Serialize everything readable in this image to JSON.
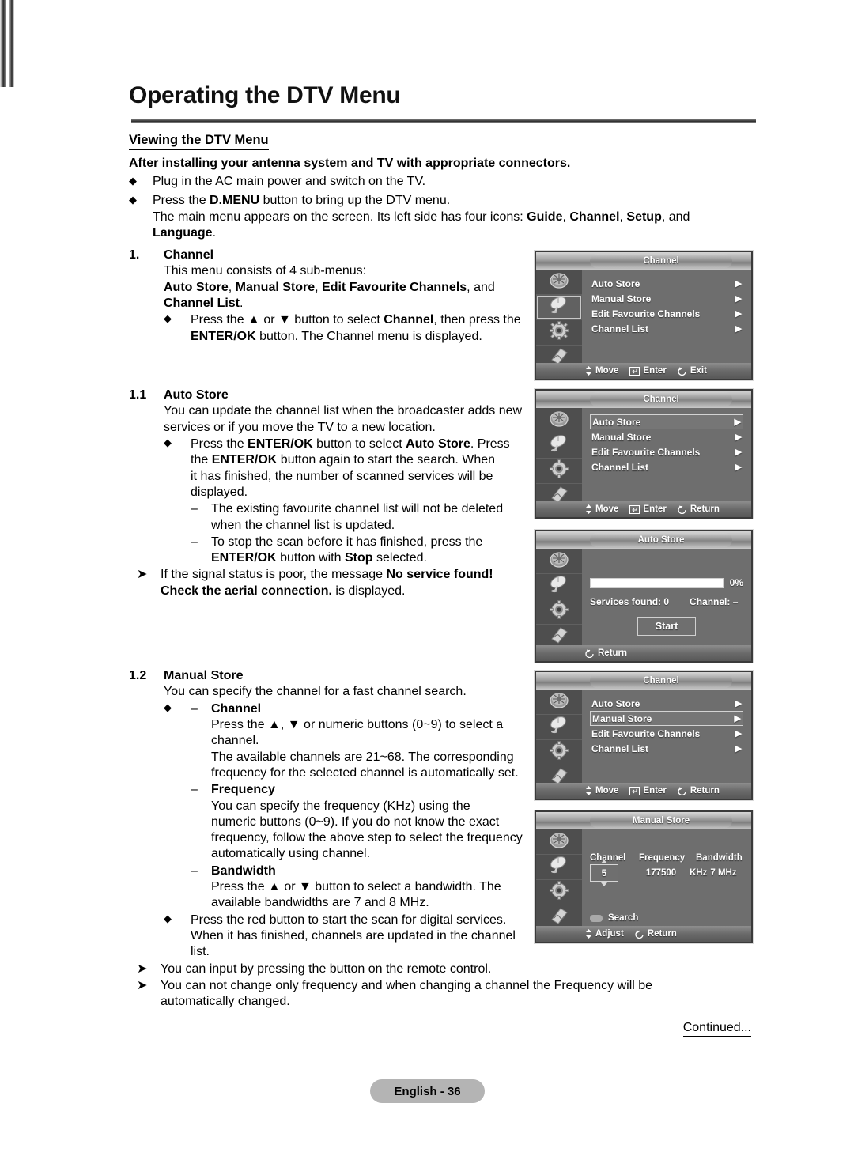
{
  "header": {
    "title": "Operating the DTV Menu",
    "subhead": "Viewing the DTV Menu",
    "lead": "After installing your antenna system and TV with appropriate connectors."
  },
  "intro_bullets": [
    {
      "glyph": "◆",
      "text": "Plug in the AC main power and switch on the TV."
    }
  ],
  "intro_bullet2": {
    "glyph": "◆",
    "line1_a": "Press the ",
    "line1_b": "D.MENU",
    "line1_c": " button to bring up the DTV menu.",
    "line2_a": "The main menu appears on the screen. Its left side has four icons: ",
    "line2_b": "Guide",
    "line2_c": ", ",
    "line2_d": "Channel",
    "line2_e": ", ",
    "line2_f": "Setup",
    "line2_g": ", and",
    "line3_a": "Language",
    "line3_b": "."
  },
  "section1": {
    "num": "1.",
    "title": "Channel",
    "p1": "This menu consists of 4 sub-menus:",
    "p2_a": "Auto Store",
    "p2_b": ", ",
    "p2_c": "Manual Store",
    "p2_d": ", ",
    "p2_e": "Edit Favourite Channels",
    "p2_f": ", and",
    "p3_a": "Channel List",
    "p3_b": ".",
    "bullet_glyph": "◆",
    "b1_a": "Press the ▲ or ▼ button to select ",
    "b1_b": "Channel",
    "b1_c": ", then press the",
    "b2_a": "ENTER/OK",
    "b2_b": " button. The Channel menu is displayed."
  },
  "section11": {
    "num": "1.1",
    "title": "Auto Store",
    "p1": "You can update the channel list when the broadcaster adds new",
    "p2": "services or if you move the TV to a new location.",
    "bullet_glyph": "◆",
    "b1_a": "Press the ",
    "b1_b": "ENTER/OK",
    "b1_c": " button to select ",
    "b1_d": "Auto Store",
    "b1_e": ". Press",
    "b2_a": "the ",
    "b2_b": "ENTER/OK",
    "b2_c": " button again to start the search. When",
    "b3": "it has finished, the number of scanned services will be",
    "b4": "displayed.",
    "dash": "–",
    "d1_l1": "The existing favourite channel list will not be deleted",
    "d1_l2": "when the channel list is updated.",
    "d2_l1": "To stop the scan before it has finished, press the",
    "d2_l2_a": "ENTER/OK",
    "d2_l2_b": " button with ",
    "d2_l2_c": "Stop",
    "d2_l2_d": " selected.",
    "arrow": "➤",
    "note_a": "If the signal status is poor, the message ",
    "note_b": "No service found!",
    "note_c": "Check the aerial connection.",
    "note_d": " is displayed."
  },
  "section12": {
    "num": "1.2",
    "title": "Manual Store",
    "p1": "You can specify the channel for a fast channel search.",
    "bullet_glyph": "◆",
    "dash": "–",
    "ch_title": "Channel",
    "ch_l1": "Press the ▲, ▼ or numeric buttons (0~9) to select a",
    "ch_l2": "channel.",
    "ch_l3": "The available channels are 21~68. The corresponding",
    "ch_l4": "frequency for the selected channel is automatically set.",
    "fr_title": "Frequency",
    "fr_l1": "You can specify the frequency (KHz) using the",
    "fr_l2": "numeric buttons (0~9). If you do not know the exact",
    "fr_l3": "frequency, follow the above step to select the frequency",
    "fr_l4": "automatically using channel.",
    "bw_title": "Bandwidth",
    "bw_l1": "Press the ▲ or ▼ button to select a bandwidth. The",
    "bw_l2": "available bandwidths are 7 and 8 MHz.",
    "red_l1": "Press the red button to start the scan for digital services.",
    "red_l2": "When it has finished, channels are updated in the channel",
    "red_l3": "list.",
    "arrow": "➤",
    "note1": "You can input by pressing the button on the remote control.",
    "note2_l1": "You can not change only frequency and when changing a channel the Frequency will be",
    "note2_l2": "automatically changed."
  },
  "osd_panels": [
    {
      "id": "channel-menu-1",
      "title": "Channel",
      "selected_rail": 1,
      "rows": [
        {
          "label": "Auto Store",
          "highlight": false
        },
        {
          "label": "Manual Store",
          "highlight": false
        },
        {
          "label": "Edit Favourite Channels",
          "highlight": false
        },
        {
          "label": "Channel List",
          "highlight": false
        }
      ],
      "hints": [
        {
          "icon": "updown-icon",
          "label": "Move"
        },
        {
          "icon": "enter-icon",
          "label": "Enter"
        },
        {
          "icon": "return-icon",
          "label": "Exit"
        }
      ]
    },
    {
      "id": "channel-menu-2",
      "title": "Channel",
      "selected_rail": 0,
      "rows": [
        {
          "label": "Auto Store",
          "highlight": true
        },
        {
          "label": "Manual Store",
          "highlight": false
        },
        {
          "label": "Edit Favourite Channels",
          "highlight": false
        },
        {
          "label": "Channel List",
          "highlight": false
        }
      ],
      "hints": [
        {
          "icon": "updown-icon",
          "label": "Move"
        },
        {
          "icon": "enter-icon",
          "label": "Enter"
        },
        {
          "icon": "return-icon",
          "label": "Return"
        }
      ]
    },
    {
      "id": "channel-menu-3",
      "title": "Channel",
      "selected_rail": -1,
      "rows": [
        {
          "label": "Auto Store",
          "highlight": false
        },
        {
          "label": "Manual Store",
          "highlight": true
        },
        {
          "label": "Edit Favourite Channels",
          "highlight": false
        },
        {
          "label": "Channel List",
          "highlight": false
        }
      ],
      "hints": [
        {
          "icon": "updown-icon",
          "label": "Move"
        },
        {
          "icon": "enter-icon",
          "label": "Enter"
        },
        {
          "icon": "return-icon",
          "label": "Return"
        }
      ]
    }
  ],
  "auto_store_panel": {
    "title": "Auto Store",
    "progress_pct": "0%",
    "progress_value": 0,
    "services_found": "Services found: 0",
    "channel": "Channel: –",
    "start_label": "Start",
    "hint": {
      "icon": "return-icon",
      "label": "Return"
    }
  },
  "manual_store_panel": {
    "title": "Manual Store",
    "col_channel": "Channel",
    "col_frequency": "Frequency",
    "col_bandwidth": "Bandwidth",
    "channel_value": "5",
    "frequency_value": "177500",
    "frequency_unit": "KHz",
    "bandwidth_value": "7 MHz",
    "search_label": "Search",
    "hints": [
      {
        "icon": "updown-icon",
        "label": "Adjust"
      },
      {
        "icon": "return-icon",
        "label": "Return"
      }
    ]
  },
  "footer": {
    "continued": "Continued...",
    "page": "English - 36"
  },
  "colors": {
    "osd_body": "#6e6e6e",
    "osd_rail": "#4e4e4e",
    "page_badge": "#b4b4b4"
  }
}
